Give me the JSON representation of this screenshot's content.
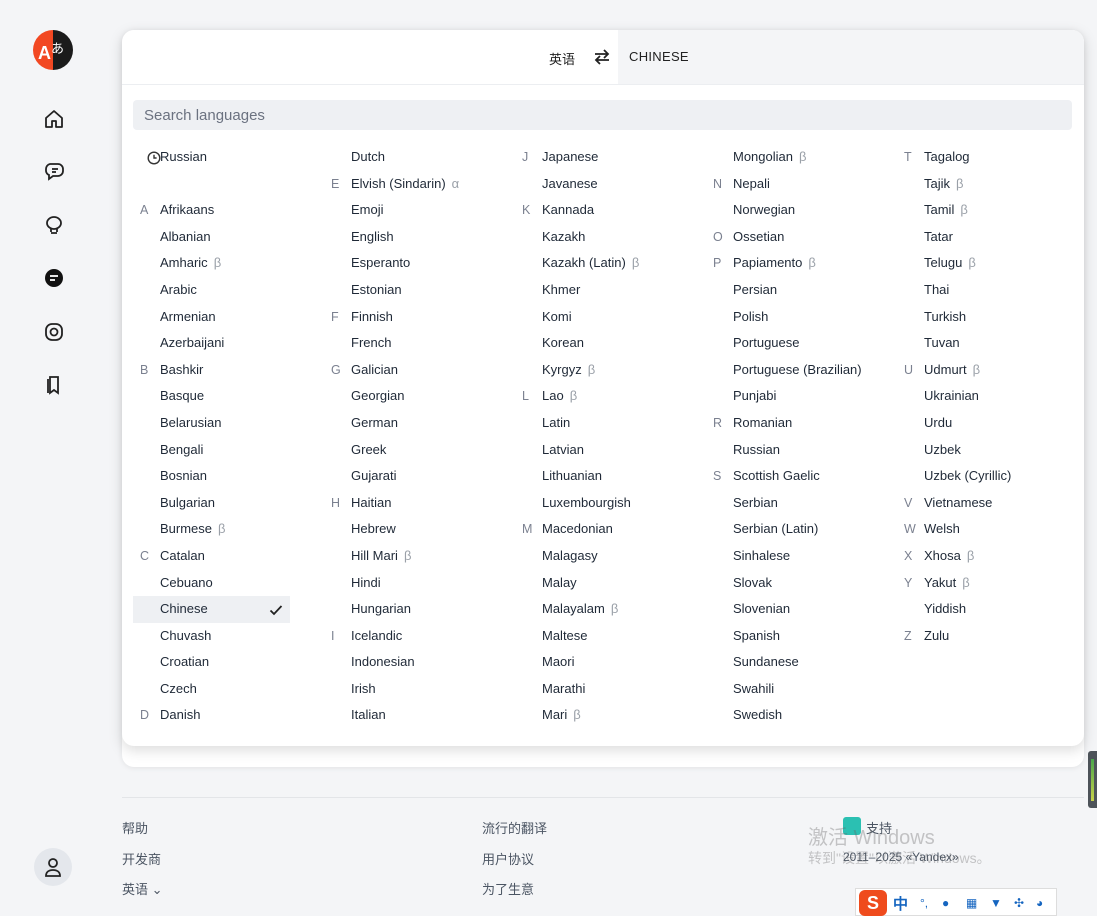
{
  "colors": {
    "accent": "#f24822",
    "selected_bg": "#eef0f3",
    "beta": "#9aa0a8"
  },
  "header": {
    "source_lang": "英语",
    "target_lang": "CHINESE"
  },
  "search": {
    "placeholder": "Search languages"
  },
  "columns": [
    [
      {
        "letter": "",
        "name": "Russian",
        "recent": true
      },
      {
        "letter": "",
        "name": "",
        "spacer": true
      },
      {
        "letter": "A",
        "name": "Afrikaans"
      },
      {
        "letter": "",
        "name": "Albanian"
      },
      {
        "letter": "",
        "name": "Amharic",
        "beta": "β"
      },
      {
        "letter": "",
        "name": "Arabic"
      },
      {
        "letter": "",
        "name": "Armenian"
      },
      {
        "letter": "",
        "name": "Azerbaijani"
      },
      {
        "letter": "B",
        "name": "Bashkir"
      },
      {
        "letter": "",
        "name": "Basque"
      },
      {
        "letter": "",
        "name": "Belarusian"
      },
      {
        "letter": "",
        "name": "Bengali"
      },
      {
        "letter": "",
        "name": "Bosnian"
      },
      {
        "letter": "",
        "name": "Bulgarian"
      },
      {
        "letter": "",
        "name": "Burmese",
        "beta": "β"
      },
      {
        "letter": "C",
        "name": "Catalan"
      },
      {
        "letter": "",
        "name": "Cebuano"
      },
      {
        "letter": "",
        "name": "Chinese",
        "selected": true
      },
      {
        "letter": "",
        "name": "Chuvash"
      },
      {
        "letter": "",
        "name": "Croatian"
      },
      {
        "letter": "",
        "name": "Czech"
      },
      {
        "letter": "D",
        "name": "Danish"
      }
    ],
    [
      {
        "letter": "",
        "name": "Dutch"
      },
      {
        "letter": "E",
        "name": "Elvish (Sindarin)",
        "beta": "α"
      },
      {
        "letter": "",
        "name": "Emoji"
      },
      {
        "letter": "",
        "name": "English"
      },
      {
        "letter": "",
        "name": "Esperanto"
      },
      {
        "letter": "",
        "name": "Estonian"
      },
      {
        "letter": "F",
        "name": "Finnish"
      },
      {
        "letter": "",
        "name": "French"
      },
      {
        "letter": "G",
        "name": "Galician"
      },
      {
        "letter": "",
        "name": "Georgian"
      },
      {
        "letter": "",
        "name": "German"
      },
      {
        "letter": "",
        "name": "Greek"
      },
      {
        "letter": "",
        "name": "Gujarati"
      },
      {
        "letter": "H",
        "name": "Haitian"
      },
      {
        "letter": "",
        "name": "Hebrew"
      },
      {
        "letter": "",
        "name": "Hill Mari",
        "beta": "β"
      },
      {
        "letter": "",
        "name": "Hindi"
      },
      {
        "letter": "",
        "name": "Hungarian"
      },
      {
        "letter": "I",
        "name": "Icelandic"
      },
      {
        "letter": "",
        "name": "Indonesian"
      },
      {
        "letter": "",
        "name": "Irish"
      },
      {
        "letter": "",
        "name": "Italian"
      }
    ],
    [
      {
        "letter": "J",
        "name": "Japanese"
      },
      {
        "letter": "",
        "name": "Javanese"
      },
      {
        "letter": "K",
        "name": "Kannada"
      },
      {
        "letter": "",
        "name": "Kazakh"
      },
      {
        "letter": "",
        "name": "Kazakh (Latin)",
        "beta": "β"
      },
      {
        "letter": "",
        "name": "Khmer"
      },
      {
        "letter": "",
        "name": "Komi"
      },
      {
        "letter": "",
        "name": "Korean"
      },
      {
        "letter": "",
        "name": "Kyrgyz",
        "beta": "β"
      },
      {
        "letter": "L",
        "name": "Lao",
        "beta": "β"
      },
      {
        "letter": "",
        "name": "Latin"
      },
      {
        "letter": "",
        "name": "Latvian"
      },
      {
        "letter": "",
        "name": "Lithuanian"
      },
      {
        "letter": "",
        "name": "Luxembourgish"
      },
      {
        "letter": "M",
        "name": "Macedonian"
      },
      {
        "letter": "",
        "name": "Malagasy"
      },
      {
        "letter": "",
        "name": "Malay"
      },
      {
        "letter": "",
        "name": "Malayalam",
        "beta": "β"
      },
      {
        "letter": "",
        "name": "Maltese"
      },
      {
        "letter": "",
        "name": "Maori"
      },
      {
        "letter": "",
        "name": "Marathi"
      },
      {
        "letter": "",
        "name": "Mari",
        "beta": "β"
      }
    ],
    [
      {
        "letter": "",
        "name": "Mongolian",
        "beta": "β"
      },
      {
        "letter": "N",
        "name": "Nepali"
      },
      {
        "letter": "",
        "name": "Norwegian"
      },
      {
        "letter": "O",
        "name": "Ossetian"
      },
      {
        "letter": "P",
        "name": "Papiamento",
        "beta": "β"
      },
      {
        "letter": "",
        "name": "Persian"
      },
      {
        "letter": "",
        "name": "Polish"
      },
      {
        "letter": "",
        "name": "Portuguese"
      },
      {
        "letter": "",
        "name": "Portuguese (Brazilian)"
      },
      {
        "letter": "",
        "name": "Punjabi"
      },
      {
        "letter": "R",
        "name": "Romanian"
      },
      {
        "letter": "",
        "name": "Russian"
      },
      {
        "letter": "S",
        "name": "Scottish Gaelic"
      },
      {
        "letter": "",
        "name": "Serbian"
      },
      {
        "letter": "",
        "name": "Serbian (Latin)"
      },
      {
        "letter": "",
        "name": "Sinhalese"
      },
      {
        "letter": "",
        "name": "Slovak"
      },
      {
        "letter": "",
        "name": "Slovenian"
      },
      {
        "letter": "",
        "name": "Spanish"
      },
      {
        "letter": "",
        "name": "Sundanese"
      },
      {
        "letter": "",
        "name": "Swahili"
      },
      {
        "letter": "",
        "name": "Swedish"
      }
    ],
    [
      {
        "letter": "T",
        "name": "Tagalog"
      },
      {
        "letter": "",
        "name": "Tajik",
        "beta": "β"
      },
      {
        "letter": "",
        "name": "Tamil",
        "beta": "β"
      },
      {
        "letter": "",
        "name": "Tatar"
      },
      {
        "letter": "",
        "name": "Telugu",
        "beta": "β"
      },
      {
        "letter": "",
        "name": "Thai"
      },
      {
        "letter": "",
        "name": "Turkish"
      },
      {
        "letter": "",
        "name": "Tuvan"
      },
      {
        "letter": "U",
        "name": "Udmurt",
        "beta": "β"
      },
      {
        "letter": "",
        "name": "Ukrainian"
      },
      {
        "letter": "",
        "name": "Urdu"
      },
      {
        "letter": "",
        "name": "Uzbek"
      },
      {
        "letter": "",
        "name": "Uzbek (Cyrillic)"
      },
      {
        "letter": "V",
        "name": "Vietnamese"
      },
      {
        "letter": "W",
        "name": "Welsh"
      },
      {
        "letter": "X",
        "name": "Xhosa",
        "beta": "β"
      },
      {
        "letter": "Y",
        "name": "Yakut",
        "beta": "β"
      },
      {
        "letter": "",
        "name": "Yiddish"
      },
      {
        "letter": "Z",
        "name": "Zulu"
      }
    ]
  ],
  "footer": {
    "help": "帮助",
    "developers": "开发商",
    "language": "英语",
    "popular": "流行的翻译",
    "terms": "用户协议",
    "business": "为了生意",
    "support": "支持",
    "copyright": "2011–2025 «Yandex»"
  },
  "watermark": {
    "line1": "激活 Windows",
    "line2": "转到\"设置\"以激活 Windows。"
  },
  "ime": {
    "logo": "S",
    "mode": "中"
  }
}
